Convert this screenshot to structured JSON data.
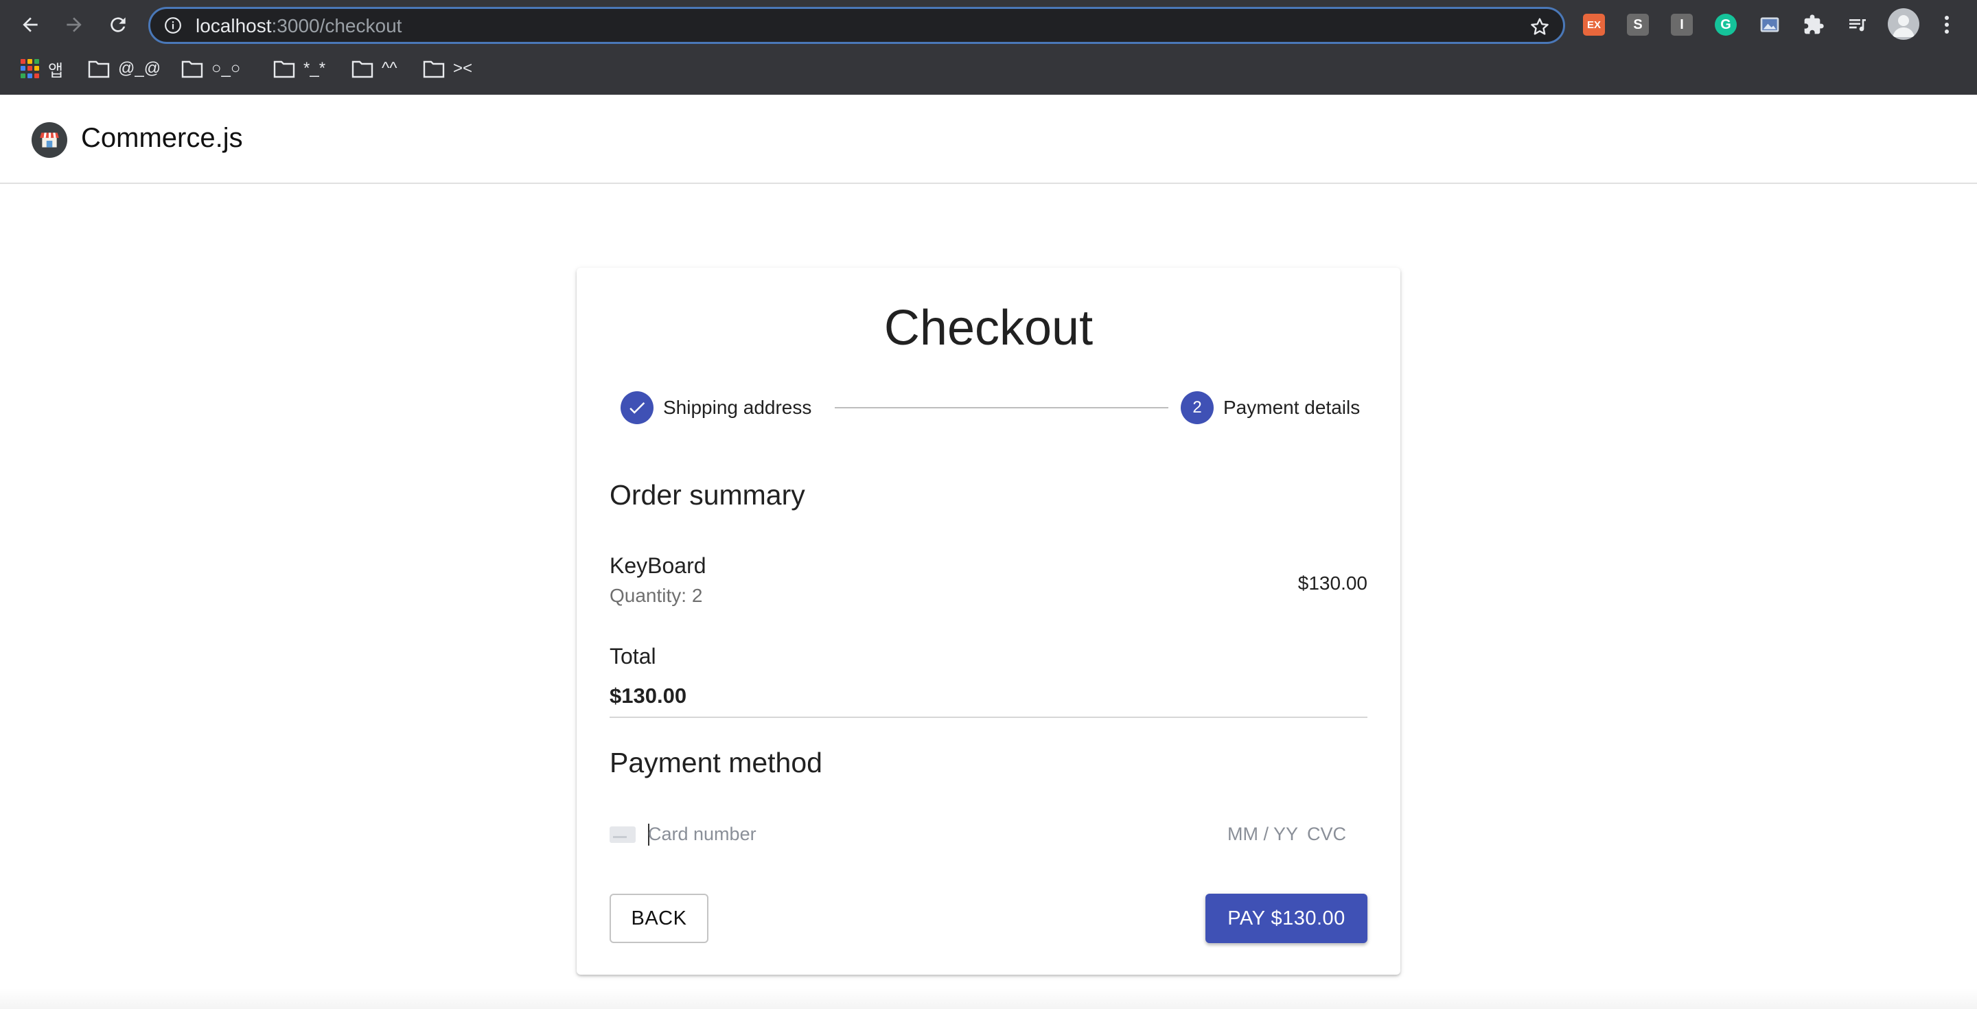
{
  "browser": {
    "url_host": "localhost",
    "url_path": ":3000/checkout",
    "extensions": [
      {
        "name": "ex-extension",
        "label": "EX",
        "color": "#e8673c"
      },
      {
        "name": "s-extension",
        "label": "S",
        "color": "#6b6b6b"
      },
      {
        "name": "i-extension",
        "label": "I",
        "color": "#6b6b6b"
      },
      {
        "name": "grammarly-extension",
        "label": "G",
        "color": "#15c39a"
      }
    ],
    "bookmarks": [
      {
        "label": "앱"
      },
      {
        "label": "@_@"
      },
      {
        "label": "○_○"
      },
      {
        "label": "*_*"
      },
      {
        "label": "^^"
      },
      {
        "label": "><"
      }
    ]
  },
  "app": {
    "brand": "Commerce.js"
  },
  "checkout": {
    "title": "Checkout",
    "steps": [
      {
        "label": "Shipping address",
        "state": "completed"
      },
      {
        "label": "Payment details",
        "number": "2",
        "state": "active"
      }
    ],
    "order_summary_title": "Order summary",
    "items": [
      {
        "name": "KeyBoard",
        "quantity_text": "Quantity: 2",
        "price": "$130.00"
      }
    ],
    "total_label": "Total",
    "total_value": "$130.00",
    "payment_method_title": "Payment method",
    "card_number_placeholder": "Card number",
    "expiry_placeholder": "MM / YY",
    "cvc_placeholder": "CVC",
    "back_label": "BACK",
    "pay_label": "PAY $130.00"
  },
  "colors": {
    "primary": "#3f51b5",
    "chrome_bg": "#35363a",
    "omnibox_bg": "#202124"
  }
}
